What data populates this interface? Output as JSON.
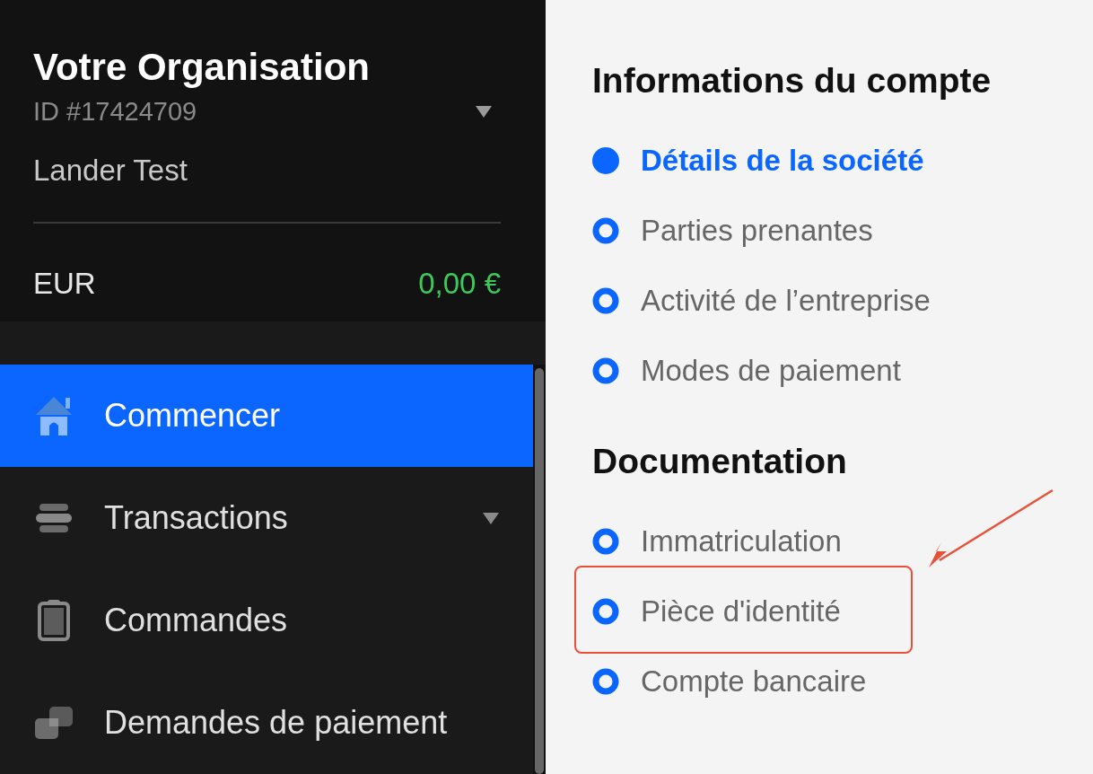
{
  "organization": {
    "name": "Votre Organisation",
    "id": "ID #17424709",
    "user": "Lander Test"
  },
  "balance": {
    "currency": "EUR",
    "amount": "0,00 €"
  },
  "nav": [
    {
      "label": "Commencer",
      "kind": "home",
      "selected": true,
      "expandable": false
    },
    {
      "label": "Transactions",
      "kind": "stack",
      "selected": false,
      "expandable": true
    },
    {
      "label": "Commandes",
      "kind": "clipboard",
      "selected": false,
      "expandable": false
    },
    {
      "label": "Demandes de paiement",
      "kind": "squares",
      "selected": false,
      "expandable": false
    }
  ],
  "sections": [
    {
      "title": "Informations du compte",
      "steps": [
        {
          "label": "Détails de la société",
          "selected": true,
          "annotated": false
        },
        {
          "label": "Parties prenantes",
          "selected": false,
          "annotated": false
        },
        {
          "label": "Activité de l’entreprise",
          "selected": false,
          "annotated": false
        },
        {
          "label": "Modes de paiement",
          "selected": false,
          "annotated": false
        }
      ]
    },
    {
      "title": "Documentation",
      "steps": [
        {
          "label": "Immatriculation",
          "selected": false,
          "annotated": false
        },
        {
          "label": "Pièce d'identité",
          "selected": false,
          "annotated": true
        },
        {
          "label": "Compte bancaire",
          "selected": false,
          "annotated": false
        }
      ]
    }
  ]
}
